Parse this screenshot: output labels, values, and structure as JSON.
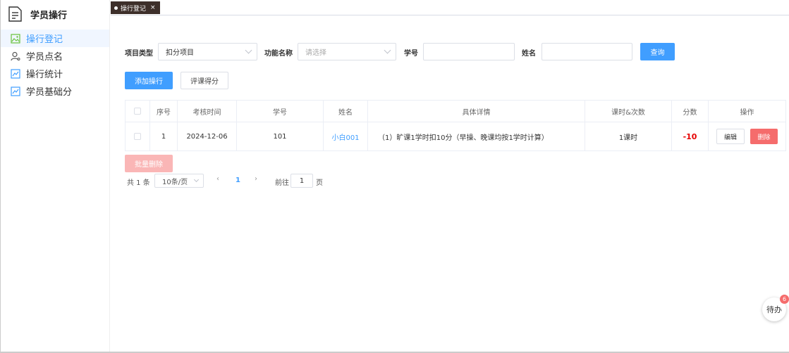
{
  "sidebar": {
    "title": "学员操行",
    "items": [
      {
        "label": "操行登记",
        "icon": "image-icon",
        "active": true
      },
      {
        "label": "学员点名",
        "icon": "user-icon",
        "active": false
      },
      {
        "label": "操行统计",
        "icon": "chart-icon",
        "active": false
      },
      {
        "label": "学员基础分",
        "icon": "chart-icon",
        "active": false
      }
    ]
  },
  "tabs": [
    {
      "label": "操行登记",
      "active": true
    }
  ],
  "search": {
    "type_label": "项目类型",
    "type_value": "扣分项目",
    "func_label": "功能名称",
    "func_placeholder": "请选择",
    "student_no_label": "学号",
    "student_no_value": "",
    "name_label": "姓名",
    "name_value": "",
    "query_button": "查询"
  },
  "actions": {
    "add_button": "添加操行",
    "rate_button": "评课得分",
    "batch_delete_button": "批量删除"
  },
  "table": {
    "headers": [
      "序号",
      "考核时间",
      "学号",
      "姓名",
      "具体详情",
      "课时&次数",
      "分数",
      "操作"
    ],
    "rows": [
      {
        "index": "1",
        "date": "2024-12-06",
        "student_no": "101",
        "name": "小白001",
        "detail": "（1）旷课1学时扣10分（早操、晚课均按1学时计算）",
        "hours": "1课时",
        "score": "-10",
        "edit": "编辑",
        "delete": "删除"
      }
    ]
  },
  "pagination": {
    "total": "共 1 条",
    "page_size": "10条/页",
    "prev": "‹",
    "current_page": "1",
    "next": "›",
    "goto_label": "前往",
    "goto_value": "1",
    "page_suffix": "页"
  },
  "todo": {
    "label": "待办",
    "badge": "6"
  },
  "colors": {
    "primary": "#409eff",
    "danger": "#f56c6c",
    "score": "#e60000",
    "tab_bg": "#3d2f2a"
  }
}
